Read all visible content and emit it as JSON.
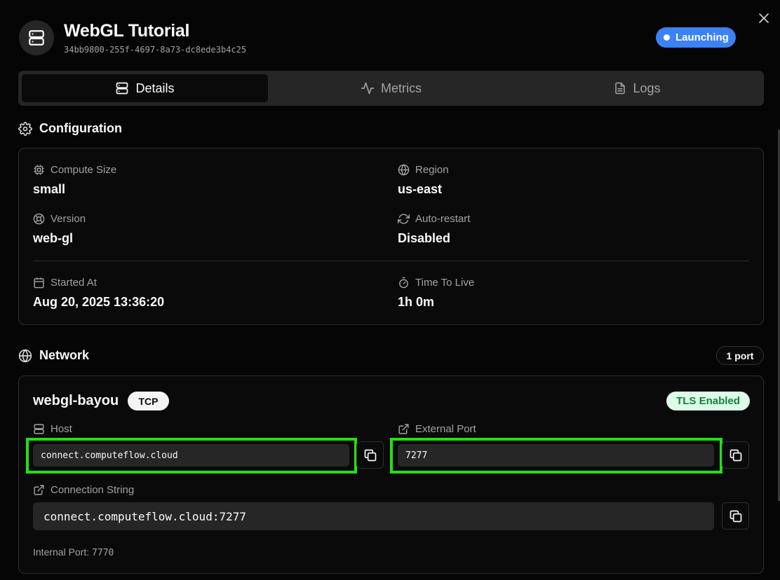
{
  "header": {
    "title": "WebGL Tutorial",
    "id": "34bb9800-255f-4697-8a73-dc8ede3b4c25",
    "status": "Launching"
  },
  "tabs": [
    {
      "label": "Details",
      "icon": "server-icon",
      "active": true
    },
    {
      "label": "Metrics",
      "icon": "activity-icon",
      "active": false
    },
    {
      "label": "Logs",
      "icon": "file-text-icon",
      "active": false
    }
  ],
  "configuration": {
    "title": "Configuration",
    "fields": {
      "compute_size": {
        "label": "Compute Size",
        "value": "small"
      },
      "region": {
        "label": "Region",
        "value": "us-east"
      },
      "version": {
        "label": "Version",
        "value": "web-gl"
      },
      "auto_restart": {
        "label": "Auto-restart",
        "value": "Disabled"
      },
      "started_at": {
        "label": "Started At",
        "value": "Aug 20, 2025 13:36:20"
      },
      "ttl": {
        "label": "Time To Live",
        "value": "1h 0m"
      }
    }
  },
  "network": {
    "title": "Network",
    "port_count": "1 port",
    "service": {
      "name": "webgl-bayou",
      "protocol": "TCP",
      "tls": "TLS Enabled",
      "host": {
        "label": "Host",
        "value": "connect.computeflow.cloud"
      },
      "external_port": {
        "label": "External Port",
        "value": "7277"
      },
      "connection_string": {
        "label": "Connection String",
        "value": "connect.computeflow.cloud:7277"
      },
      "internal_port": {
        "label": "Internal Port:",
        "value": "7770"
      }
    }
  },
  "colors": {
    "accent_blue": "#3b82f6",
    "highlight_green": "#22e014",
    "tls_bg": "#dcfce7",
    "tls_text": "#15803d",
    "background": "#050505"
  }
}
